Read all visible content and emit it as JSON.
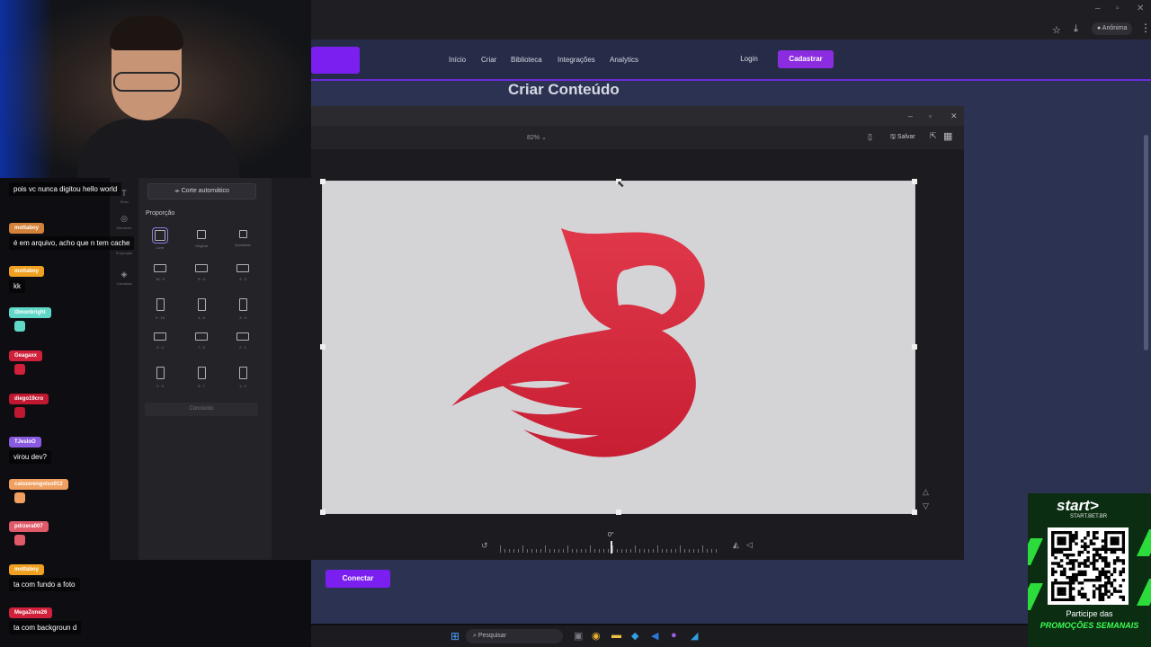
{
  "site": {
    "nav": [
      "Início",
      "Criar",
      "Biblioteca",
      "Integrações",
      "Analytics"
    ],
    "login": "Login",
    "signup": "Cadastrar",
    "page_title": "Criar Conteúdo",
    "connect_button": "Conectar"
  },
  "browser": {
    "profile_label": "Anônima"
  },
  "editor": {
    "zoom": "82% ⌄",
    "save_label": "Salvar",
    "auto_crop": "Corte automático",
    "proportion_label": "Proporção",
    "rail": [
      "Texto",
      "Elemento",
      "Proporção",
      "Camadas"
    ],
    "ratios": [
      {
        "label": "Livre",
        "selected": true,
        "shape": "free"
      },
      {
        "label": "Original",
        "shape": "image"
      },
      {
        "label": "Quadrado",
        "shape": "square"
      },
      {
        "label": "16 : 9",
        "shape": "wide"
      },
      {
        "label": "5 : 4",
        "shape": "wide"
      },
      {
        "label": "4 : 3",
        "shape": "wide"
      },
      {
        "label": "9 : 16",
        "shape": "tall"
      },
      {
        "label": "4 : 5",
        "shape": "tall"
      },
      {
        "label": "3 : 4",
        "shape": "tall"
      },
      {
        "label": "3 : 2",
        "shape": "wide"
      },
      {
        "label": "7 : 5",
        "shape": "wide"
      },
      {
        "label": "2 : 1",
        "shape": "wide"
      },
      {
        "label": "2 : 3",
        "shape": "tall"
      },
      {
        "label": "5 : 7",
        "shape": "tall"
      },
      {
        "label": "1 : 2",
        "shape": "tall"
      }
    ],
    "done_button": "Concluído",
    "rotation": "0°",
    "logo_color": "#d42a3c"
  },
  "taskbar": {
    "search_placeholder": "Pesquisar"
  },
  "chat": [
    {
      "user": "",
      "text": "pois vc nunca digitou hello world",
      "color": "#b02030"
    },
    {
      "user": "mottaboy",
      "text": "é em arquivo, acho que n tem cache",
      "color": "#d4823a"
    },
    {
      "user": "mottaboy",
      "text": "kk",
      "color": "#f0a020"
    },
    {
      "user": "l3monbright",
      "text": "",
      "color": "#5fd8c8",
      "emote": true
    },
    {
      "user": "Geagaxx",
      "text": "",
      "color": "#d0203a",
      "emote": true
    },
    {
      "user": "diego19cro",
      "text": "",
      "color": "#c01830",
      "emote": true
    },
    {
      "user": "TJesloO",
      "text": "virou dev?",
      "color": "#8a5ae0"
    },
    {
      "user": "caiozerengolso012",
      "text": "",
      "color": "#f0a060",
      "emote": true
    },
    {
      "user": "pdrzera007",
      "text": "",
      "color": "#e05a6a",
      "emote": true
    },
    {
      "user": "mottaboy",
      "text": "ta com fundo a foto",
      "color": "#f0a020"
    },
    {
      "user": "MegaZone26",
      "text": "ta com backgroun d",
      "color": "#d0203a"
    }
  ],
  "ad": {
    "brand": "start>",
    "site": "START.BET.BR",
    "cta_line1": "Participe das",
    "cta_line2": "PROMOÇÕES SEMANAIS"
  }
}
